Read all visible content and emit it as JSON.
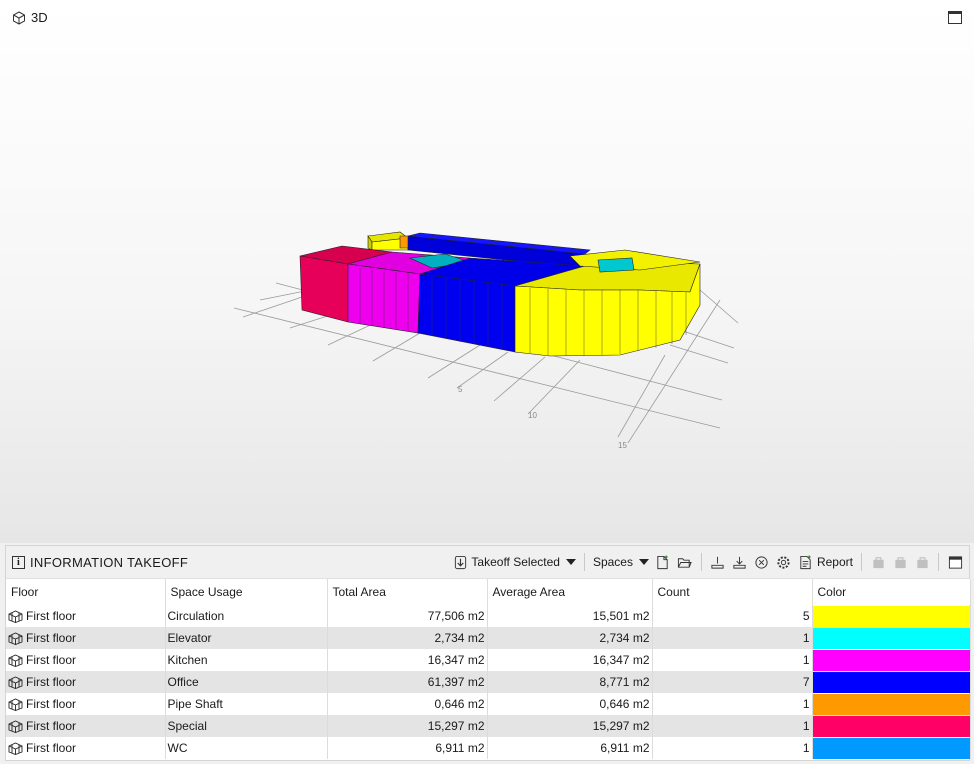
{
  "viewport": {
    "title": "3D",
    "cube_icon": "cube-icon",
    "maximize_icon": "maximize-icon",
    "axis_labels": [
      "5",
      "10",
      "15"
    ]
  },
  "panel": {
    "title": "INFORMATION TAKEOFF",
    "info_icon": "info-icon",
    "toolbar": {
      "takeoff_selected": "Takeoff Selected",
      "spaces": "Spaces",
      "report": "Report",
      "icons": [
        "takeoff-icon",
        "new-file-icon",
        "open-folder-icon",
        "export-icon",
        "download-icon",
        "clear-icon",
        "settings-icon",
        "report-icon",
        "bag-icon",
        "bag-icon",
        "bag-icon",
        "maximize-icon"
      ]
    },
    "columns": [
      "Floor",
      "Space Usage",
      "Total Area",
      "Average Area",
      "Count",
      "Color"
    ],
    "rows": [
      {
        "floor": "First floor",
        "usage": "Circulation",
        "total": "77,506 m2",
        "average": "15,501 m2",
        "count": "5",
        "color": "#ffff00"
      },
      {
        "floor": "First floor",
        "usage": "Elevator",
        "total": "2,734 m2",
        "average": "2,734 m2",
        "count": "1",
        "color": "#00ffff"
      },
      {
        "floor": "First floor",
        "usage": "Kitchen",
        "total": "16,347 m2",
        "average": "16,347 m2",
        "count": "1",
        "color": "#ff00ff"
      },
      {
        "floor": "First floor",
        "usage": "Office",
        "total": "61,397 m2",
        "average": "8,771 m2",
        "count": "7",
        "color": "#0000ff"
      },
      {
        "floor": "First floor",
        "usage": "Pipe Shaft",
        "total": "0,646 m2",
        "average": "0,646 m2",
        "count": "1",
        "color": "#ff9900"
      },
      {
        "floor": "First floor",
        "usage": "Special",
        "total": "15,297 m2",
        "average": "15,297 m2",
        "count": "1",
        "color": "#ff0066"
      },
      {
        "floor": "First floor",
        "usage": "WC",
        "total": "6,911 m2",
        "average": "6,911 m2",
        "count": "1",
        "color": "#0099ff"
      }
    ]
  }
}
